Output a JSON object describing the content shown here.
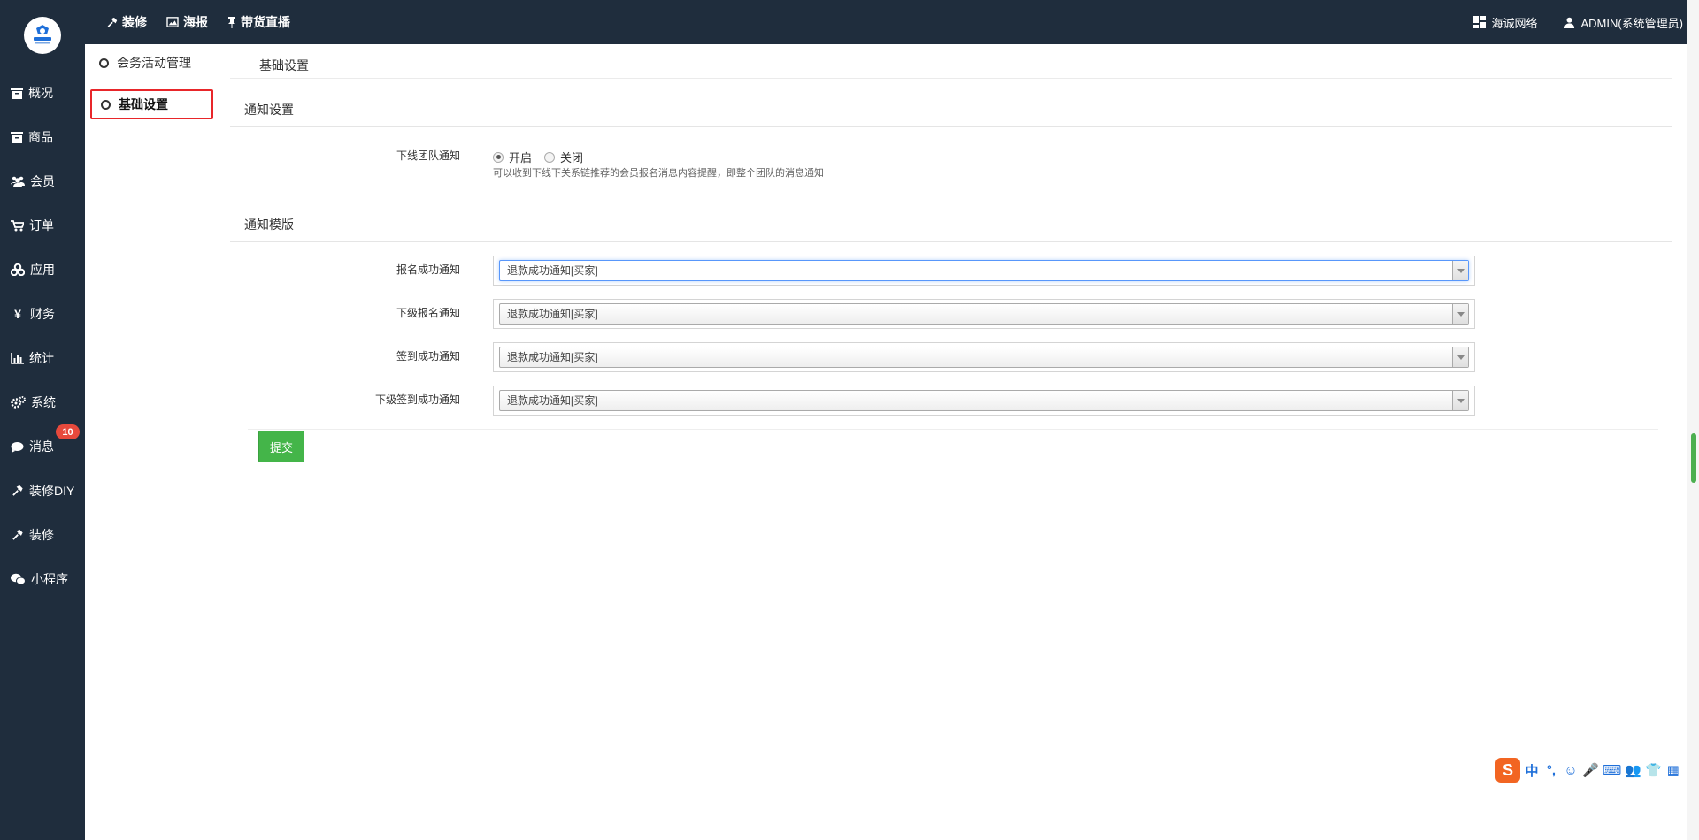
{
  "topbar": {
    "nav": [
      {
        "label": "装修",
        "icon": "hammer-icon"
      },
      {
        "label": "海报",
        "icon": "image-icon"
      },
      {
        "label": "带货直播",
        "icon": "pin-icon"
      }
    ],
    "right": [
      {
        "label": "海诚网络",
        "icon": "grid-icon"
      },
      {
        "label": "ADMIN(系统管理员)",
        "icon": "user-icon"
      }
    ]
  },
  "sidebar": {
    "items": [
      {
        "label": "概况",
        "icon": "box-icon"
      },
      {
        "label": "商品",
        "icon": "box-icon"
      },
      {
        "label": "会员",
        "icon": "users-icon"
      },
      {
        "label": "订单",
        "icon": "cart-icon"
      },
      {
        "label": "应用",
        "icon": "apps-icon"
      },
      {
        "label": "财务",
        "icon": "yen-icon"
      },
      {
        "label": "统计",
        "icon": "chart-icon"
      },
      {
        "label": "系统",
        "icon": "gears-icon"
      },
      {
        "label": "消息",
        "icon": "chat-icon",
        "badge": "10"
      },
      {
        "label": "装修DIY",
        "icon": "hammer-icon"
      },
      {
        "label": "装修",
        "icon": "hammer-icon"
      },
      {
        "label": "小程序",
        "icon": "wechat-icon"
      }
    ],
    "badge_color": "#e7493c",
    "background": "#1f2d3d"
  },
  "subpanel": {
    "items": [
      {
        "label": "会务活动管理",
        "active": false
      },
      {
        "label": "基础设置",
        "active": true
      }
    ],
    "active_border_color": "#e8262a"
  },
  "main": {
    "page_title": "基础设置",
    "notify_section": {
      "title": "通知设置",
      "field_label": "下线团队通知",
      "options": [
        {
          "label": "开启",
          "checked": true
        },
        {
          "label": "关闭",
          "checked": false
        }
      ],
      "help": "可以收到下线下关系链推荐的会员报名消息内容提醒，即整个团队的消息通知"
    },
    "template_section": {
      "title": "通知模版",
      "fields": [
        {
          "label": "报名成功通知",
          "value": "退款成功通知[买家]"
        },
        {
          "label": "下级报名通知",
          "value": "退款成功通知[买家]"
        },
        {
          "label": "签到成功通知",
          "value": "退款成功通知[买家]"
        },
        {
          "label": "下级签到成功通知",
          "value": "退款成功通知[买家]"
        }
      ]
    },
    "submit_label": "提交",
    "submit_color": "#44b549"
  },
  "ime": {
    "items": [
      "中",
      "°,",
      "☺",
      "🎤",
      "⌨",
      "👥",
      "👕",
      "▦"
    ]
  }
}
